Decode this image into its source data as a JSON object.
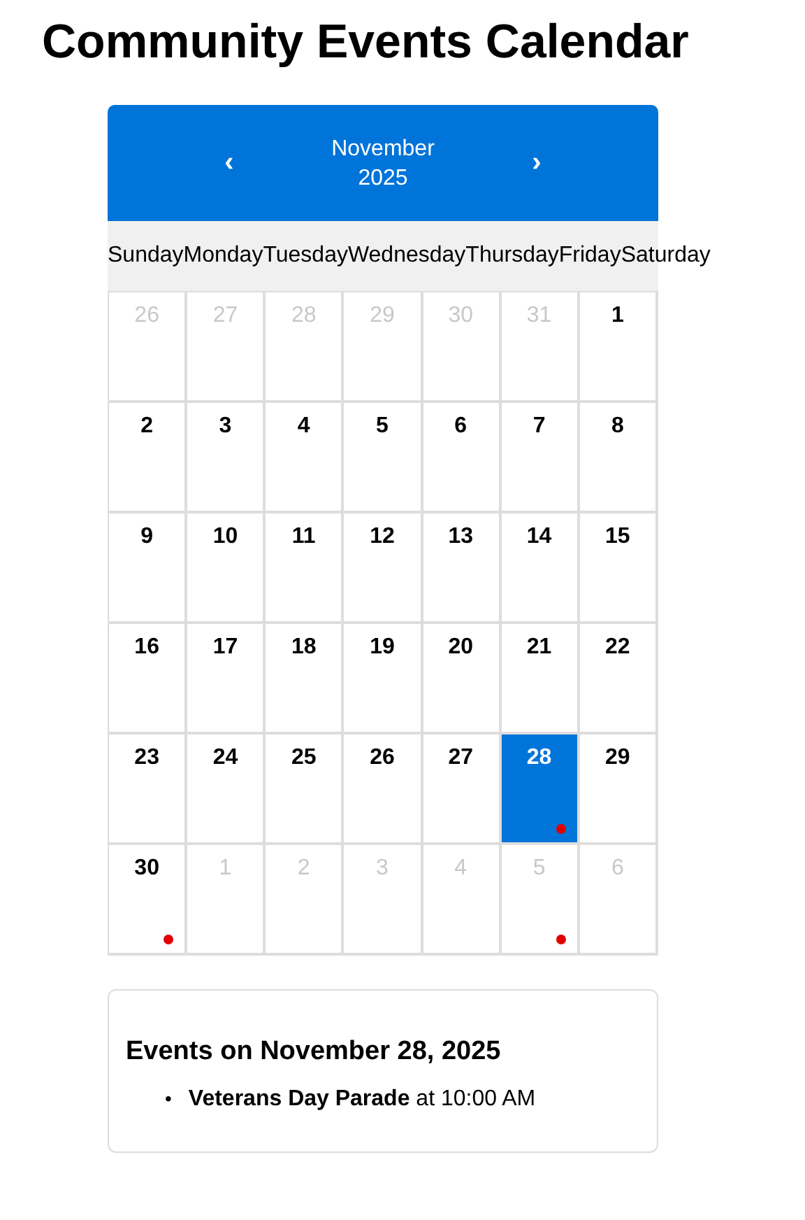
{
  "title": "Community Events Calendar",
  "calendar": {
    "prev": "‹",
    "month": "November",
    "year": "2025",
    "next": "›",
    "weekdays": [
      "Sunday",
      "Monday",
      "Tuesday",
      "Wednesday",
      "Thursday",
      "Friday",
      "Saturday"
    ],
    "days": [
      {
        "day": "26",
        "outside": true,
        "selected": false,
        "has_event": false
      },
      {
        "day": "27",
        "outside": true,
        "selected": false,
        "has_event": false
      },
      {
        "day": "28",
        "outside": true,
        "selected": false,
        "has_event": false
      },
      {
        "day": "29",
        "outside": true,
        "selected": false,
        "has_event": false
      },
      {
        "day": "30",
        "outside": true,
        "selected": false,
        "has_event": false
      },
      {
        "day": "31",
        "outside": true,
        "selected": false,
        "has_event": false
      },
      {
        "day": "1",
        "outside": false,
        "selected": false,
        "has_event": false
      },
      {
        "day": "2",
        "outside": false,
        "selected": false,
        "has_event": false
      },
      {
        "day": "3",
        "outside": false,
        "selected": false,
        "has_event": false
      },
      {
        "day": "4",
        "outside": false,
        "selected": false,
        "has_event": false
      },
      {
        "day": "5",
        "outside": false,
        "selected": false,
        "has_event": false
      },
      {
        "day": "6",
        "outside": false,
        "selected": false,
        "has_event": false
      },
      {
        "day": "7",
        "outside": false,
        "selected": false,
        "has_event": false
      },
      {
        "day": "8",
        "outside": false,
        "selected": false,
        "has_event": false
      },
      {
        "day": "9",
        "outside": false,
        "selected": false,
        "has_event": false
      },
      {
        "day": "10",
        "outside": false,
        "selected": false,
        "has_event": false
      },
      {
        "day": "11",
        "outside": false,
        "selected": false,
        "has_event": false
      },
      {
        "day": "12",
        "outside": false,
        "selected": false,
        "has_event": false
      },
      {
        "day": "13",
        "outside": false,
        "selected": false,
        "has_event": false
      },
      {
        "day": "14",
        "outside": false,
        "selected": false,
        "has_event": false
      },
      {
        "day": "15",
        "outside": false,
        "selected": false,
        "has_event": false
      },
      {
        "day": "16",
        "outside": false,
        "selected": false,
        "has_event": false
      },
      {
        "day": "17",
        "outside": false,
        "selected": false,
        "has_event": false
      },
      {
        "day": "18",
        "outside": false,
        "selected": false,
        "has_event": false
      },
      {
        "day": "19",
        "outside": false,
        "selected": false,
        "has_event": false
      },
      {
        "day": "20",
        "outside": false,
        "selected": false,
        "has_event": false
      },
      {
        "day": "21",
        "outside": false,
        "selected": false,
        "has_event": false
      },
      {
        "day": "22",
        "outside": false,
        "selected": false,
        "has_event": false
      },
      {
        "day": "23",
        "outside": false,
        "selected": false,
        "has_event": false
      },
      {
        "day": "24",
        "outside": false,
        "selected": false,
        "has_event": false
      },
      {
        "day": "25",
        "outside": false,
        "selected": false,
        "has_event": false
      },
      {
        "day": "26",
        "outside": false,
        "selected": false,
        "has_event": false
      },
      {
        "day": "27",
        "outside": false,
        "selected": false,
        "has_event": false
      },
      {
        "day": "28",
        "outside": false,
        "selected": true,
        "has_event": true
      },
      {
        "day": "29",
        "outside": false,
        "selected": false,
        "has_event": false
      },
      {
        "day": "30",
        "outside": false,
        "selected": false,
        "has_event": true
      },
      {
        "day": "1",
        "outside": true,
        "selected": false,
        "has_event": false
      },
      {
        "day": "2",
        "outside": true,
        "selected": false,
        "has_event": false
      },
      {
        "day": "3",
        "outside": true,
        "selected": false,
        "has_event": false
      },
      {
        "day": "4",
        "outside": true,
        "selected": false,
        "has_event": false
      },
      {
        "day": "5",
        "outside": true,
        "selected": false,
        "has_event": true
      },
      {
        "day": "6",
        "outside": true,
        "selected": false,
        "has_event": false
      }
    ]
  },
  "events_panel": {
    "heading": "Events on November 28, 2025",
    "events": [
      {
        "bullet": "•",
        "text": "**Veterans Day Parade** at 10:00 AM"
      }
    ]
  }
}
